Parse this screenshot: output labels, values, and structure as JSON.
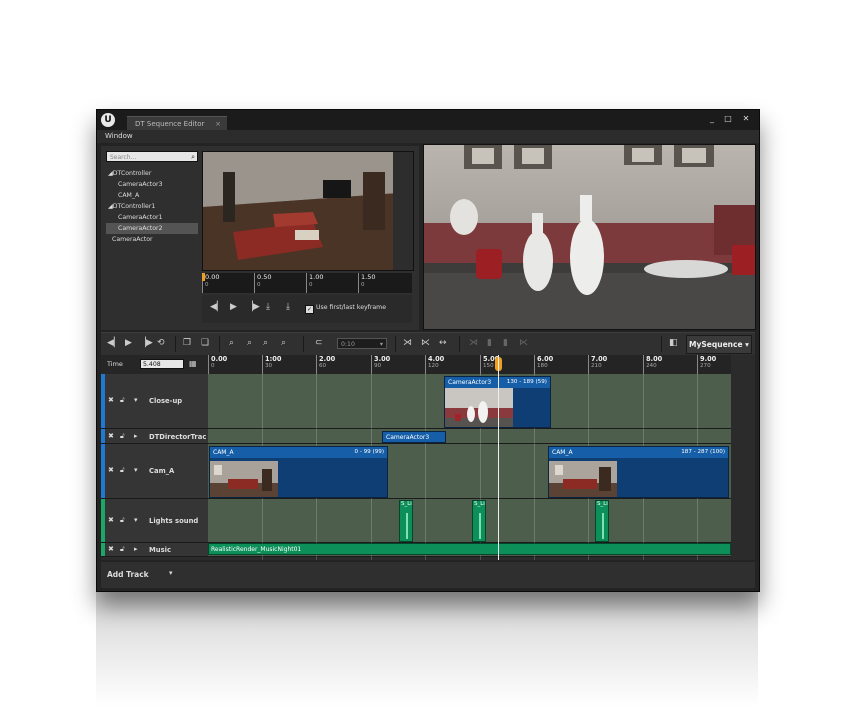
{
  "window": {
    "tab_title": "DT Sequence Editor",
    "tab_close": "×",
    "menu": [
      "Window"
    ],
    "buttons": {
      "minimize": "_",
      "maximize": "□",
      "close": "✕"
    }
  },
  "outliner": {
    "search_placeholder": "Search...",
    "items": [
      {
        "label": "◢DTController",
        "indent": 0,
        "selected": false
      },
      {
        "label": "CameraActor3",
        "indent": 1,
        "selected": false
      },
      {
        "label": "CAM_A",
        "indent": 1,
        "selected": false
      },
      {
        "label": "◢DTController1",
        "indent": 0,
        "selected": false
      },
      {
        "label": "CameraActor1",
        "indent": 1,
        "selected": false
      },
      {
        "label": "CameraActor2",
        "indent": 1,
        "selected": true
      },
      {
        "label": "CameraActor",
        "indent": 0,
        "selected": false
      }
    ]
  },
  "preview": {
    "scrub_ticks": [
      {
        "time": "0.00",
        "frame": "0"
      },
      {
        "time": "0.50",
        "frame": "0"
      },
      {
        "time": "1.00",
        "frame": "0"
      },
      {
        "time": "1.50",
        "frame": "0"
      }
    ],
    "checkbox_label": "Use first/last keyframe",
    "checkbox_checked": true
  },
  "toolbar": {
    "snap_value": "0:10",
    "sequence_button": "MySequence ▾"
  },
  "timeline": {
    "time_label": "Time",
    "time_value": "5.408",
    "ruler": [
      {
        "t": "0.00",
        "f": "0"
      },
      {
        "t": "1:00",
        "f": "30"
      },
      {
        "t": "2.00",
        "f": "60"
      },
      {
        "t": "3.00",
        "f": "90"
      },
      {
        "t": "4.00",
        "f": "120"
      },
      {
        "t": "5.00",
        "f": "150"
      },
      {
        "t": "6.00",
        "f": "180"
      },
      {
        "t": "7.00",
        "f": "210"
      },
      {
        "t": "8.00",
        "f": "240"
      },
      {
        "t": "9.00",
        "f": "270"
      }
    ],
    "tracks": [
      "Close-up",
      "DTDirectorTrac",
      "Cam_A",
      "Lights sound",
      "Music"
    ],
    "shots": {
      "closeup_name": "CameraActor3",
      "closeup_range": "130 - 189 (59)",
      "director_name": "CameraActor3",
      "cama1_name": "CAM_A",
      "cama1_range": "0 - 99 (99)",
      "cama2_name": "CAM_A",
      "cama2_range": "187 - 287 (100)"
    },
    "sound_label": "S_Li",
    "music_clip": "RealisticRender_MusicNight01",
    "playhead_time": 5.408
  },
  "footer": {
    "add_track": "Add Track",
    "add_track_caret": "▾"
  },
  "colors": {
    "accent_blue": "#165fa8",
    "accent_green": "#0d8f5a",
    "lane_bg": "#4e5e4c",
    "playhead": "#f0a020"
  }
}
